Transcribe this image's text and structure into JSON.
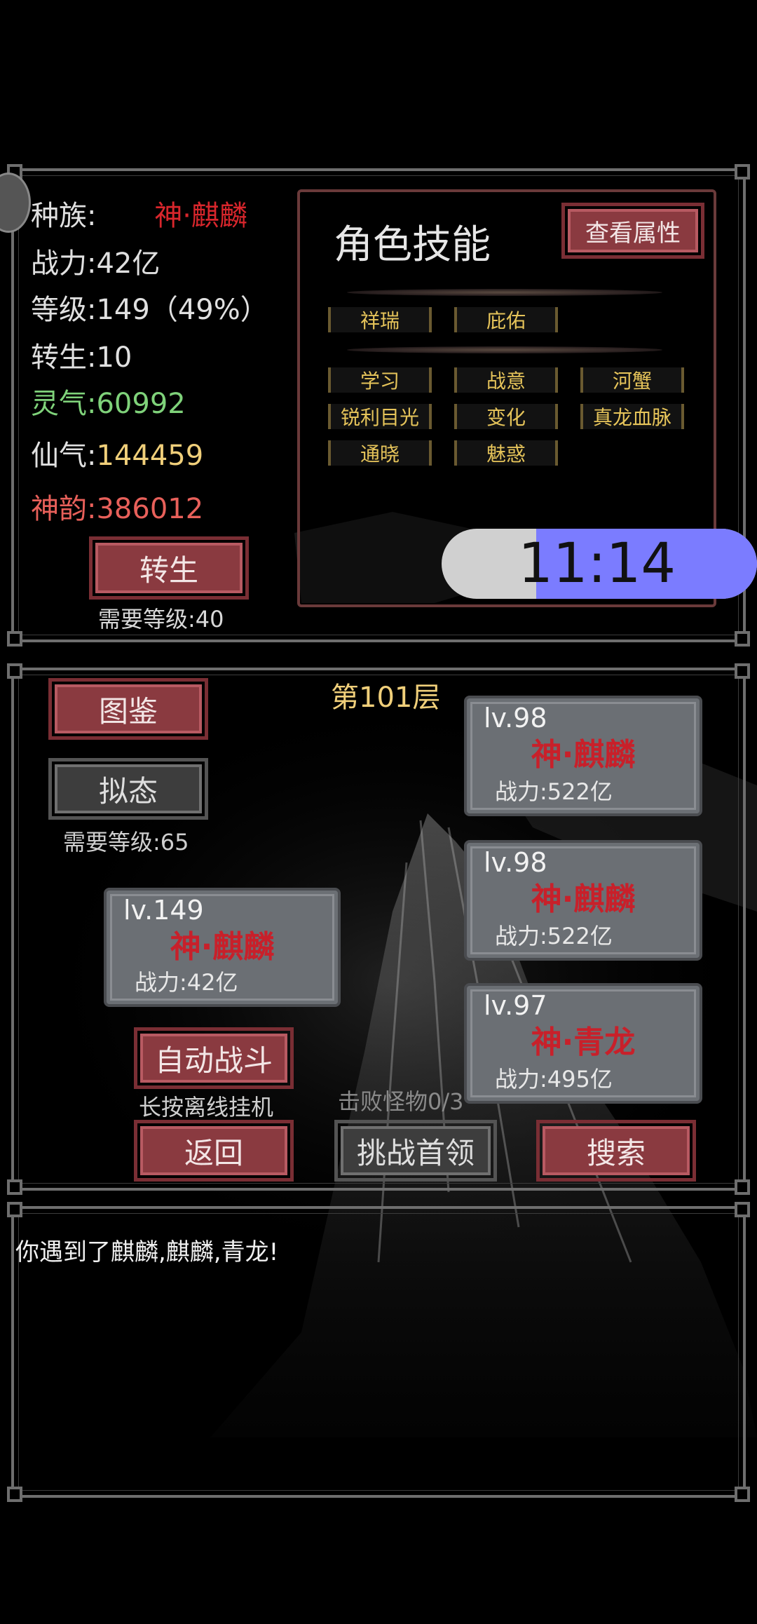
{
  "stats": {
    "race_label": "种族:",
    "race_value": "神·麒麟",
    "power_label": "战力:",
    "power_value": "42亿",
    "level_label": "等级:",
    "level_value": "149（49%）",
    "rebirth_label": "转生:",
    "rebirth_value": "10",
    "lingqi_label": "灵气:",
    "lingqi_value": "60992",
    "xianqi_label": "仙气:",
    "xianqi_value": "144459",
    "shenyun_label": "神韵:",
    "shenyun_value": "386012"
  },
  "rebirth_button": {
    "label": "转生",
    "requirement": "需要等级:40"
  },
  "skills": {
    "title": "角色技能",
    "view_attributes_label": "查看属性",
    "row1": [
      "祥瑞",
      "庇佑"
    ],
    "row2": [
      "学习",
      "战意",
      "河蟹"
    ],
    "row3": [
      "锐利目光",
      "变化",
      "真龙血脉"
    ],
    "row4": [
      "通晓",
      "魅惑"
    ]
  },
  "clock": {
    "time": "11:14",
    "fill_fraction": 0.7
  },
  "battle": {
    "floor": "第101层",
    "codex_label": "图鉴",
    "mimic_label": "拟态",
    "mimic_requirement": "需要等级:65",
    "player": {
      "level": "lv.149",
      "name": "神·麒麟",
      "power": "战力:42亿"
    },
    "enemies": [
      {
        "level": "lv.98",
        "name": "神·麒麟",
        "power": "战力:522亿"
      },
      {
        "level": "lv.98",
        "name": "神·麒麟",
        "power": "战力:522亿"
      },
      {
        "level": "lv.97",
        "name": "神·青龙",
        "power": "战力:495亿"
      }
    ],
    "auto_battle_label": "自动战斗",
    "auto_battle_hint": "长按离线挂机",
    "defeat_progress": "击败怪物0/3",
    "back_label": "返回",
    "challenge_boss_label": "挑战首领",
    "search_label": "搜索"
  },
  "log": {
    "message": "你遇到了麒麟,麒麟,青龙!"
  },
  "colors": {
    "race_red": "#d8262c",
    "lingqi_green": "#7fd27a",
    "xianqi_gold": "#f0cf7a",
    "shenyun_red": "#e8605a",
    "skill_gold": "#e6c45a",
    "button_red": "#8a3a40",
    "clock_blue": "#7b7cff"
  }
}
